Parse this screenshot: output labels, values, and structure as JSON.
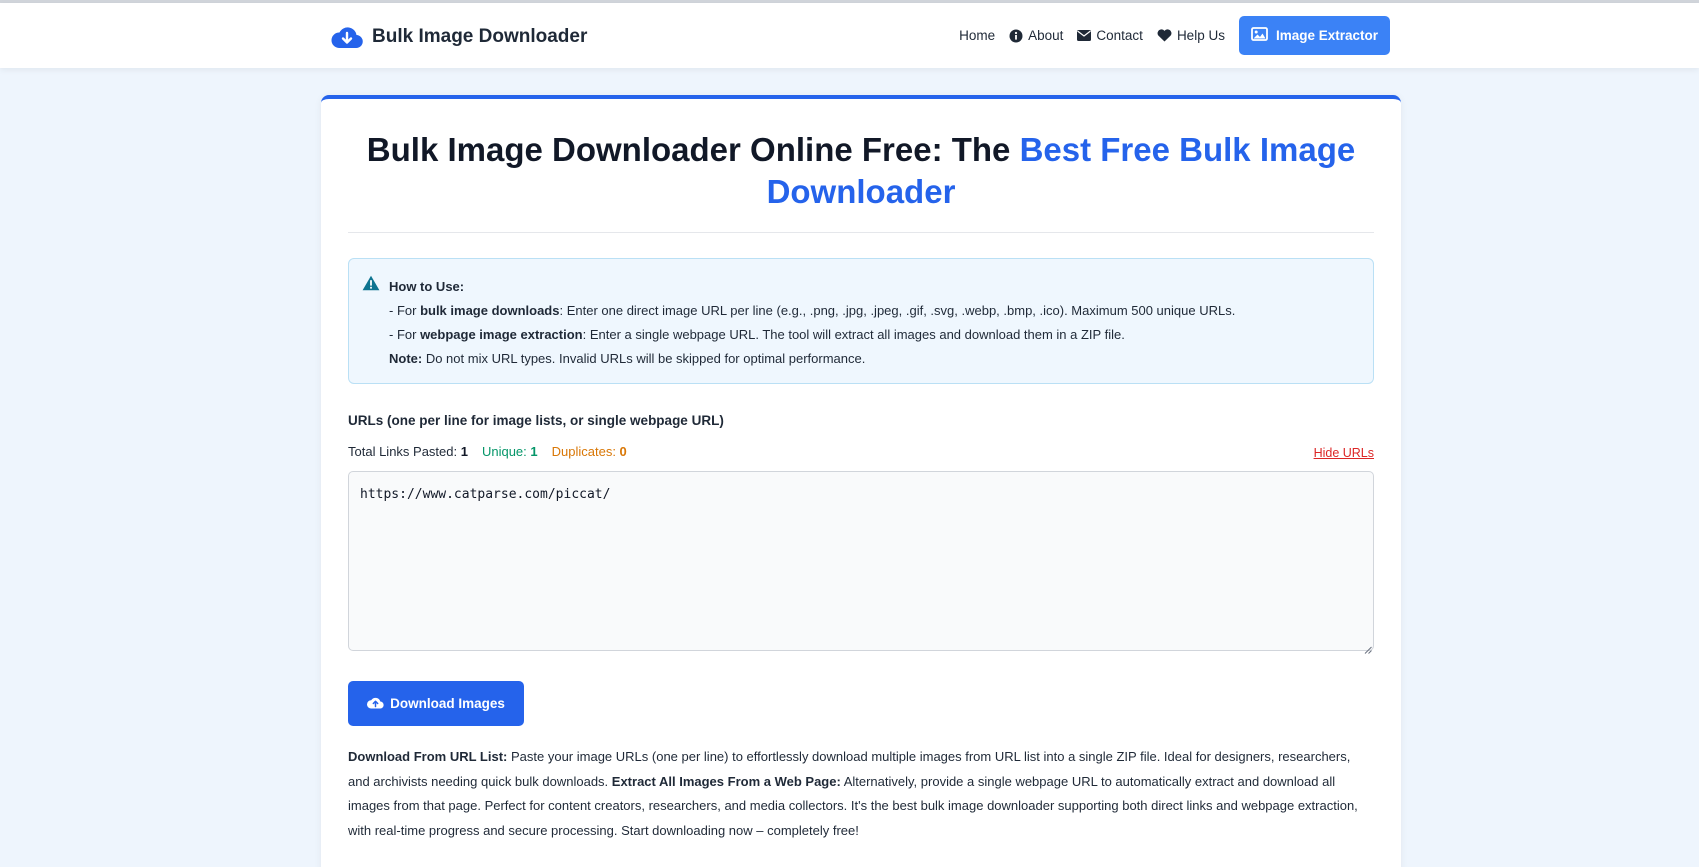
{
  "navbar": {
    "brand": "Bulk Image Downloader",
    "links": [
      "Home",
      "About",
      "Contact",
      "Help Us"
    ],
    "cta": "Image Extractor"
  },
  "hero": {
    "title_plain": "Bulk Image Downloader Online Free: The ",
    "title_accent": "Best Free Bulk Image Downloader"
  },
  "howto": {
    "heading": "How to Use:",
    "line1_prefix": "- For ",
    "line1_bold": "bulk image downloads",
    "line1_rest": ": Enter one direct image URL per line (e.g., .png, .jpg, .jpeg, .gif, .svg, .webp, .bmp, .ico). Maximum 500 unique URLs.",
    "line2_prefix": "- For ",
    "line2_bold": "webpage image extraction",
    "line2_rest": ": Enter a single webpage URL. The tool will extract all images and download them in a ZIP file.",
    "note_label": "Note:",
    "note_text": " Do not mix URL types. Invalid URLs will be skipped for optimal performance."
  },
  "form": {
    "label": "URLs (one per line for image lists, or single webpage URL)",
    "total_label": "Total Links Pasted: ",
    "total_value": "1",
    "unique_label": "Unique: ",
    "unique_value": "1",
    "dup_label": "Duplicates: ",
    "dup_value": "0",
    "hide_link": "Hide URLs",
    "urls_value": "https://www.catparse.com/piccat/",
    "download_button": "Download Images"
  },
  "description": {
    "b1": "Download From URL List:",
    "t1": " Paste your image URLs (one per line) to effortlessly download multiple images from URL list into a single ZIP file. Ideal for designers, researchers, and archivists needing quick bulk downloads. ",
    "b2": "Extract All Images From a Web Page:",
    "t2": " Alternatively, provide a single webpage URL to automatically extract and download all images from that page. Perfect for content creators, researchers, and media collectors. It's the best bulk image downloader supporting both direct links and webpage extraction, with real-time progress and secure processing. Start downloading now – completely free!"
  },
  "colors": {
    "brand_blue": "#2563eb",
    "cta_blue": "#3b82f6",
    "unique_green": "#059669",
    "duplicate_orange": "#d97706",
    "hide_red": "#dc2626"
  },
  "icons": [
    "cloud-download-icon",
    "info-circle-icon",
    "envelope-icon",
    "heart-icon",
    "image-icon",
    "warning-icon",
    "cloud-upload-icon"
  ]
}
